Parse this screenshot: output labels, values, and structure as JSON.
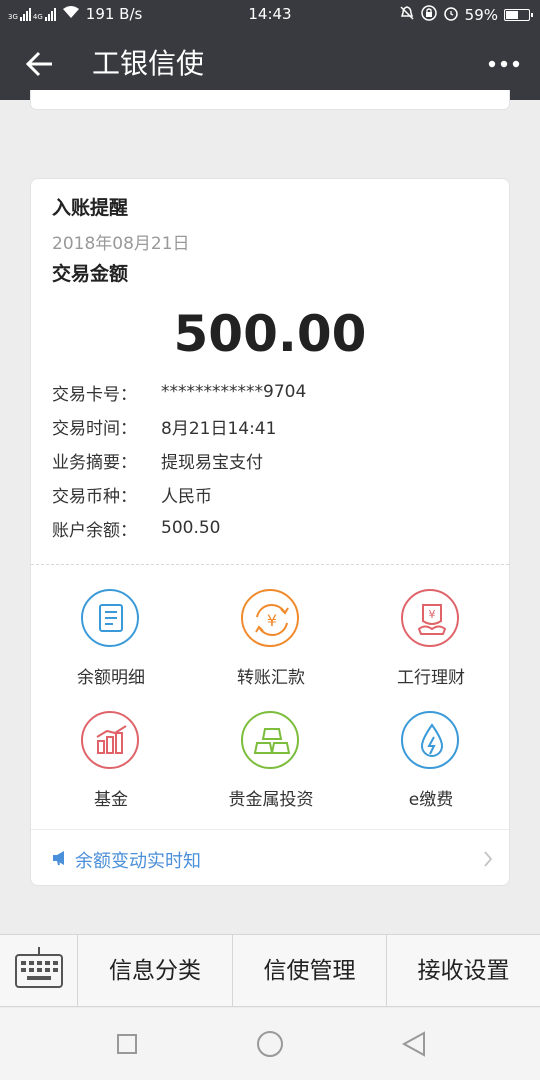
{
  "status_bar": {
    "network_tags": [
      "3G",
      "4G"
    ],
    "speed": "191 B/s",
    "time": "14:43",
    "battery": "59%",
    "battery_level": 0.59,
    "icons": [
      "signal-icon",
      "wifi-icon",
      "mute-icon",
      "lock-rotation-icon",
      "alarm-icon",
      "battery-icon"
    ]
  },
  "header": {
    "title": "工银信使"
  },
  "card": {
    "title": "入账提醒",
    "date": "2018年08月21日",
    "amount_label": "交易金额",
    "amount": "500.00",
    "details": [
      {
        "key": "交易卡号：",
        "value": "************9704"
      },
      {
        "key": "交易时间：",
        "value": "8月21日14:41"
      },
      {
        "key": "业务摘要：",
        "value": "提现易宝支付"
      },
      {
        "key": "交易币种：",
        "value": "人民币"
      },
      {
        "key": "账户余额：",
        "value": "500.50"
      }
    ],
    "services": [
      {
        "label": "余额明细",
        "icon": "statement-icon",
        "color": "#3a9ad9"
      },
      {
        "label": "转账汇款",
        "icon": "transfer-icon",
        "color": "#f08a2c"
      },
      {
        "label": "工行理财",
        "icon": "wealth-icon",
        "color": "#e0636a"
      },
      {
        "label": "基金",
        "icon": "fund-chart-icon",
        "color": "#e0636a"
      },
      {
        "label": "贵金属投资",
        "icon": "gold-bars-icon",
        "color": "#7cbd3c"
      },
      {
        "label": "e缴费",
        "icon": "water-drop-icon",
        "color": "#3a9ad9"
      }
    ],
    "notice": "余额变动实时知"
  },
  "bottom_menu": {
    "items": [
      "信息分类",
      "信使管理",
      "接收设置"
    ]
  },
  "colors": {
    "header_bg": "#393a3f",
    "link_blue": "#4a8fd9"
  }
}
